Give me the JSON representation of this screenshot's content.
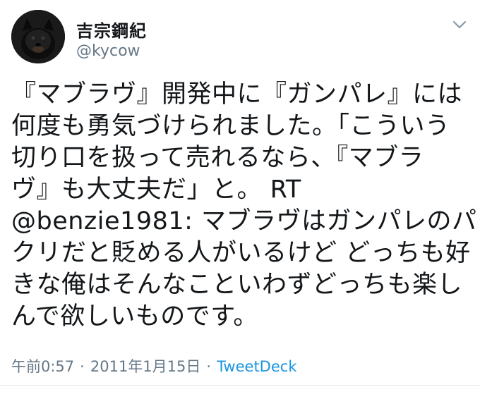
{
  "user": {
    "display_name": "吉宗鋼紀",
    "handle": "@kycow"
  },
  "icons": {
    "avatar": "profile-photo-dog",
    "more": "chevron-down-icon"
  },
  "tweet": {
    "lines": [
      "『マブラヴ』開発中に『ガンパレ』には",
      "何度も勇気づけられました。「こういう",
      "切り口を扱って売れるなら、『マブラ",
      "ヴ』も大丈夫だ」と。 RT",
      "@benzie1981: マブラヴはガンパレのパ",
      "クリだと貶める人がいるけど どっちも好",
      "きな俺はそんなこといわずどっちも楽し",
      "んで欲しいものです。"
    ]
  },
  "meta": {
    "time": "午前0:57",
    "separator": "·",
    "date": "2011年1月15日",
    "source": "TweetDeck"
  },
  "colors": {
    "text": "#14171a",
    "secondary": "#657786",
    "link": "#1b95e0"
  }
}
